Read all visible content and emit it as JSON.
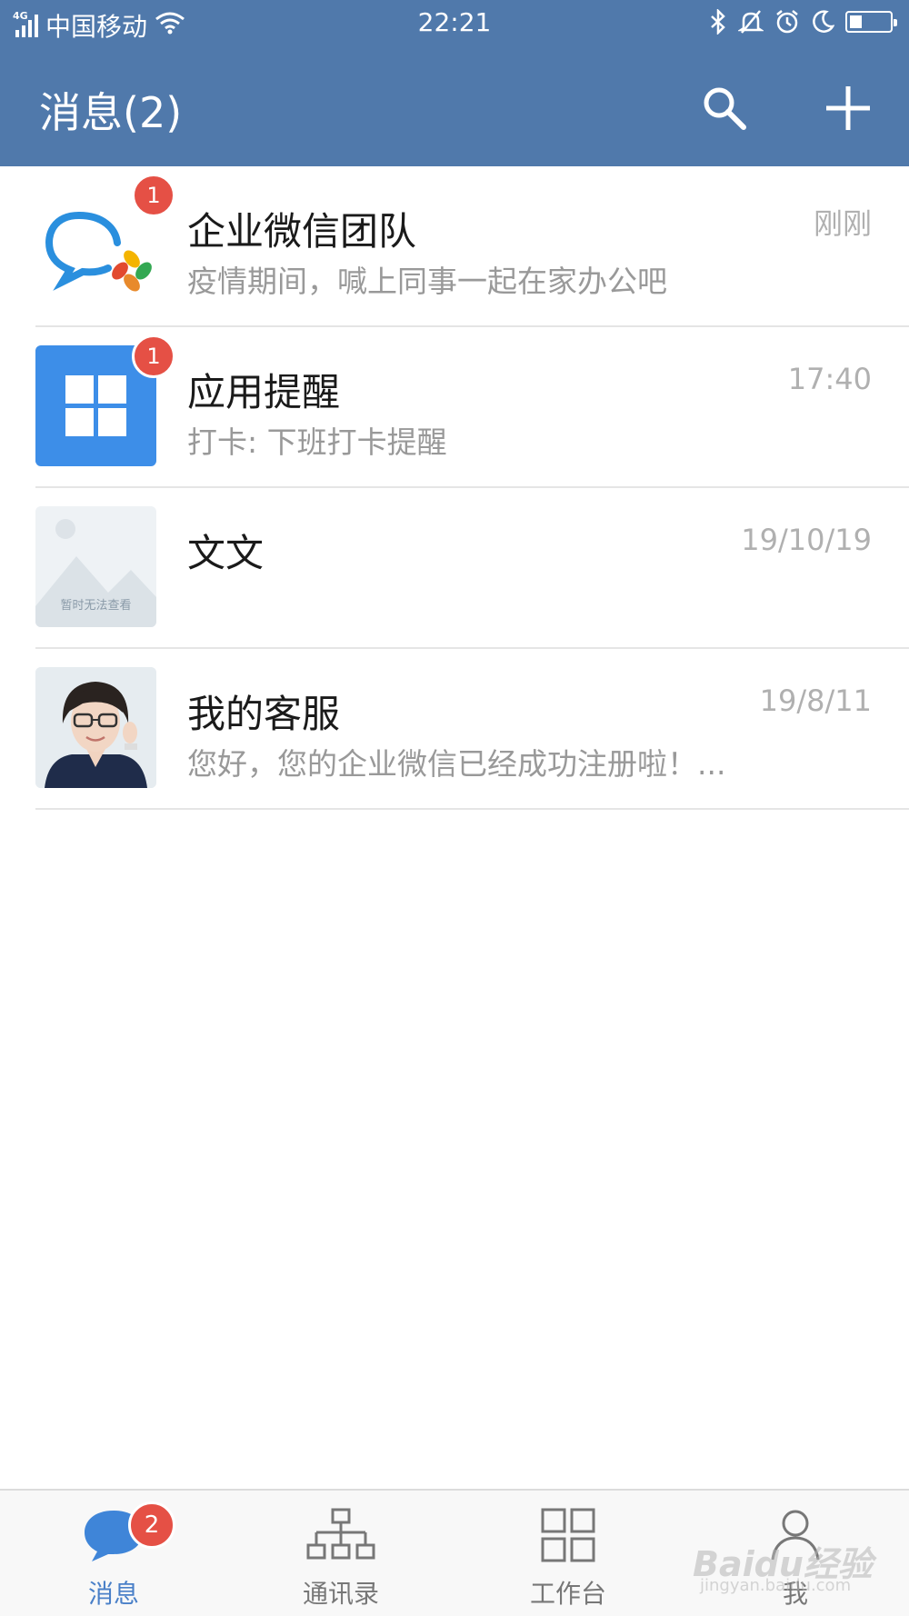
{
  "status_bar": {
    "network": "4G",
    "carrier": "中国移动",
    "time": "22:21",
    "battery_level": 0.3
  },
  "header": {
    "title": "消息(2)",
    "search_icon": "search-icon",
    "add_icon": "plus-icon"
  },
  "messages": [
    {
      "name": "企业微信团队",
      "preview": "疫情期间，喊上同事一起在家办公吧",
      "time": "刚刚",
      "badge": "1",
      "avatar": "wecom-logo"
    },
    {
      "name": "应用提醒",
      "preview": "打卡: 下班打卡提醒",
      "time": "17:40",
      "badge": "1",
      "avatar": "grid-app-icon"
    },
    {
      "name": "文文",
      "preview": "",
      "time": "19/10/19",
      "badge": "",
      "avatar": "placeholder-image",
      "avatar_text": "暂时无法查看"
    },
    {
      "name": "我的客服",
      "preview": "您好，您的企业微信已经成功注册啦！...",
      "time": "19/8/11",
      "badge": "",
      "avatar": "person-photo"
    }
  ],
  "tabs": [
    {
      "label": "消息",
      "icon": "chat-bubble-icon",
      "active": true,
      "badge": "2"
    },
    {
      "label": "通讯录",
      "icon": "org-chart-icon",
      "active": false
    },
    {
      "label": "工作台",
      "icon": "grid-icon",
      "active": false
    },
    {
      "label": "我",
      "icon": "person-icon",
      "active": false
    }
  ],
  "watermark": {
    "text": "Baidu经验",
    "sub": "jingyan.baidu.com"
  },
  "colors": {
    "header_bg": "#5079ab",
    "badge": "#e55045",
    "active_tab": "#4a80c8"
  }
}
